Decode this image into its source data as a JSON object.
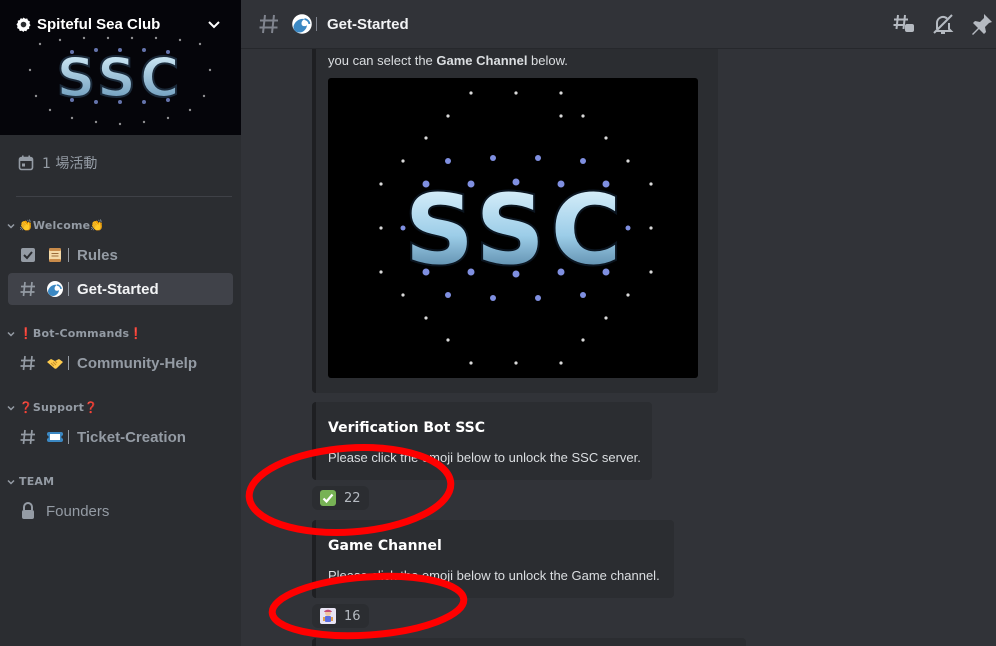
{
  "server": {
    "name": "Spiteful Sea Club",
    "banner_text": "SSC",
    "events_label": "1 場活動"
  },
  "sidebar": {
    "categories": [
      {
        "label": "👏Welcome👏",
        "channels": [
          {
            "label": "Rules",
            "icon": "rules-checkbox-icon",
            "emoji": "scroll-emoji",
            "active": false
          },
          {
            "label": "Get-Started",
            "icon": "hash-icon",
            "emoji": "wave-emoji",
            "active": true
          }
        ]
      },
      {
        "label": "❗Bot-Commands❗",
        "channels": [
          {
            "label": "Community-Help",
            "icon": "hash-icon",
            "emoji": "handshake-emoji",
            "active": false
          }
        ]
      },
      {
        "label": "❓Support❓",
        "channels": [
          {
            "label": "Ticket-Creation",
            "icon": "hash-icon",
            "emoji": "ticket-emoji",
            "active": false
          }
        ]
      },
      {
        "label": "TEAM",
        "channels": [
          {
            "label": "Founders",
            "icon": "lock-icon",
            "emoji": "",
            "active": false
          }
        ]
      }
    ]
  },
  "header": {
    "channel_name": "Get-Started",
    "icons": [
      "threads-icon",
      "mute-bell-icon",
      "pin-icon"
    ]
  },
  "messages": {
    "embed_top": {
      "prefix": "you can select the ",
      "bold": "Game Channel",
      "suffix": " below.",
      "image_text": "SSC"
    },
    "embed_verify": {
      "title": "Verification Bot SSC",
      "body": "Please click the emoji below to unlock the SSC server.",
      "reaction_emoji": "check-mark-emoji",
      "reaction_count": "22"
    },
    "embed_game": {
      "title": "Game Channel",
      "body": "Please click the emoji below to unlock the Game channel.",
      "reaction_emoji": "game-character-emoji",
      "reaction_count": "16"
    }
  },
  "colors": {
    "annotation": "#ff0000",
    "accent_check": "#3ba55c",
    "active_channel_bg": "#404249"
  }
}
